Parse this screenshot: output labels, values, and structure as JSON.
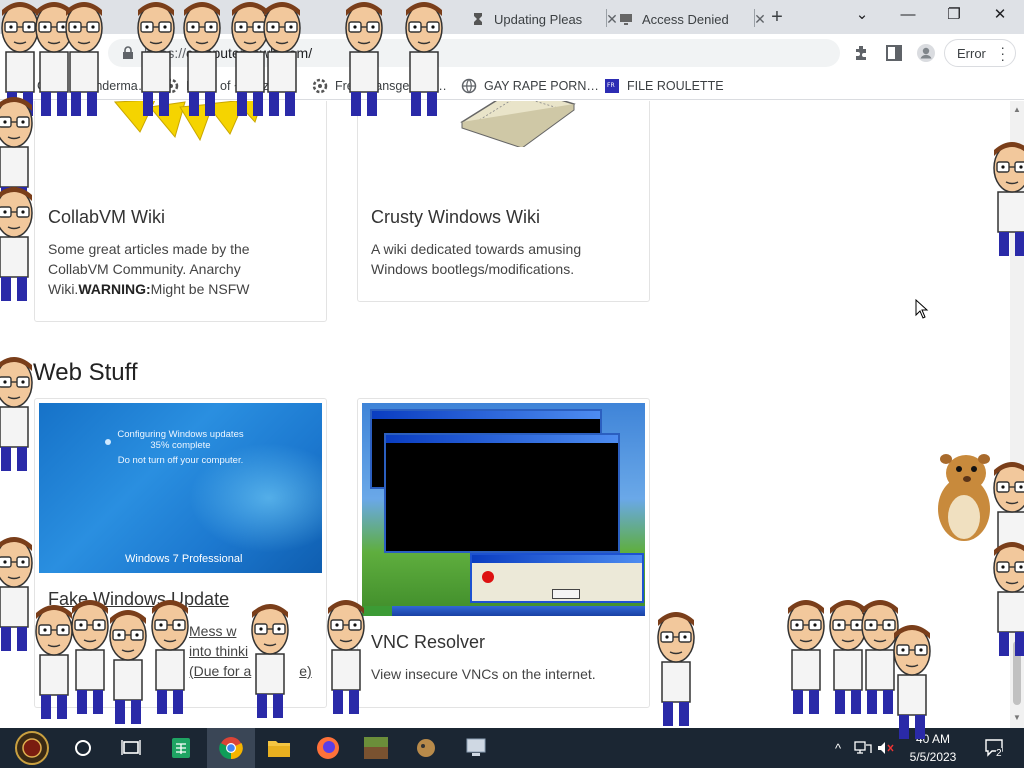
{
  "browser": {
    "tabs": [
      {
        "title": "Updating Pleas",
        "icon": "hourglass-icon"
      },
      {
        "title": "Access Denied",
        "icon": "monitor-icon"
      }
    ],
    "new_tab_label": "+",
    "url_dim": "https://",
    "url_host": "computernewb.com/",
    "profile_button": "Error"
  },
  "bookmarks": [
    {
      "label": "GitHub - Enderma…",
      "icon": "github-icon"
    },
    {
      "label": "Index of ~dartz/i…",
      "icon": "gear-icon"
    },
    {
      "label": "Free Transgender…",
      "icon": "gear-icon"
    },
    {
      "label": "GAY RAPE PORN…",
      "icon": "globe-icon"
    },
    {
      "label": "FILE ROULETTE",
      "icon": "file-icon"
    }
  ],
  "page": {
    "cards_top": [
      {
        "title": "CollabVM Wiki",
        "desc_pre": "Some great articles made by the CollabVM Community. Anarchy Wiki.",
        "desc_bold": "WARNING:",
        "desc_post": "Might be NSFW"
      },
      {
        "title": "Crusty Windows Wiki",
        "desc": "A wiki dedicated towards amusing Windows bootlegs/modifications."
      }
    ],
    "section_title": "Web Stuff",
    "cards_web": [
      {
        "title": "Fake Windows Update",
        "desc_line1": "Mess w",
        "desc_line2": "into thinki",
        "desc_line3": "(Due for a",
        "desc_line3_tail": "e)",
        "shot": {
          "line1": "Configuring Windows updates",
          "line2": "35% complete",
          "line3": "Do not turn off your computer.",
          "logo": "Windows 7 Professional"
        }
      },
      {
        "title": "VNC Resolver",
        "desc": "View insecure VNCs on the internet."
      }
    ]
  },
  "taskbar": {
    "clock_time": "40 AM",
    "clock_date": "5/5/2023",
    "notification_count": "2",
    "apps": [
      "start-button",
      "cortana-button",
      "task-view-button",
      "sheets-app",
      "chrome-app",
      "file-explorer-app",
      "firefox-app",
      "minecraft-app",
      "game-app",
      "network-app"
    ]
  },
  "colors": {
    "tab_strip": "#dee1e6",
    "taskbar": "#1b2633",
    "win7_blue": "#1672c8"
  }
}
